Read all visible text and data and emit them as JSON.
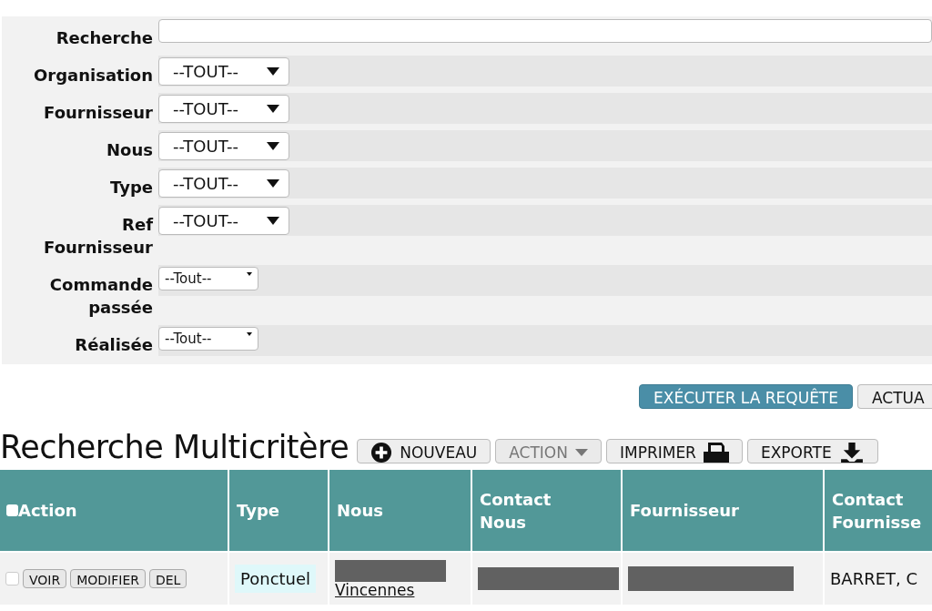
{
  "search": {
    "label": "Recherche"
  },
  "filters": [
    {
      "label": "Organisation",
      "value": "--TOUT--",
      "kind": "large"
    },
    {
      "label": "Fournisseur",
      "value": "--TOUT--",
      "kind": "large"
    },
    {
      "label": "Nous",
      "value": "--TOUT--",
      "kind": "large"
    },
    {
      "label": "Type",
      "value": "--TOUT--",
      "kind": "large"
    },
    {
      "label": "Ref Fournisseur",
      "value": "--TOUT--",
      "kind": "large"
    },
    {
      "label": "Commande passée",
      "value": "--Tout--",
      "kind": "small"
    },
    {
      "label": "Réalisée",
      "value": "--Tout--",
      "kind": "small"
    }
  ],
  "query_buttons": [
    {
      "label": "EXÉCUTER LA REQUÊTE",
      "primary": true
    },
    {
      "label": "ACTUA",
      "primary": false
    }
  ],
  "title": "Recherche Multicritère",
  "toolbar": [
    {
      "label": "NOUVEAU",
      "kind": "plus",
      "disabled": false
    },
    {
      "label": "ACTION",
      "kind": "caret",
      "disabled": true
    },
    {
      "label": "IMPRIMER",
      "kind": "printer",
      "disabled": false
    },
    {
      "label": "EXPORTE",
      "kind": "download",
      "disabled": false
    }
  ],
  "table": {
    "select_all": {
      "checked": false
    },
    "columns": [
      "Action",
      "Type",
      "Nous",
      "Contact Nous",
      "Fournisseur",
      "Contact Fournisse"
    ],
    "rows": [
      {
        "checked": false,
        "actions": [
          "VOIR",
          "MODIFIER",
          "DEL"
        ],
        "type": "Ponctuel",
        "nous": "Vincennes",
        "contact_nous_redacted": true,
        "fournisseur_redacted": true,
        "contact_fournisseur": "BARRET, C"
      }
    ]
  }
}
